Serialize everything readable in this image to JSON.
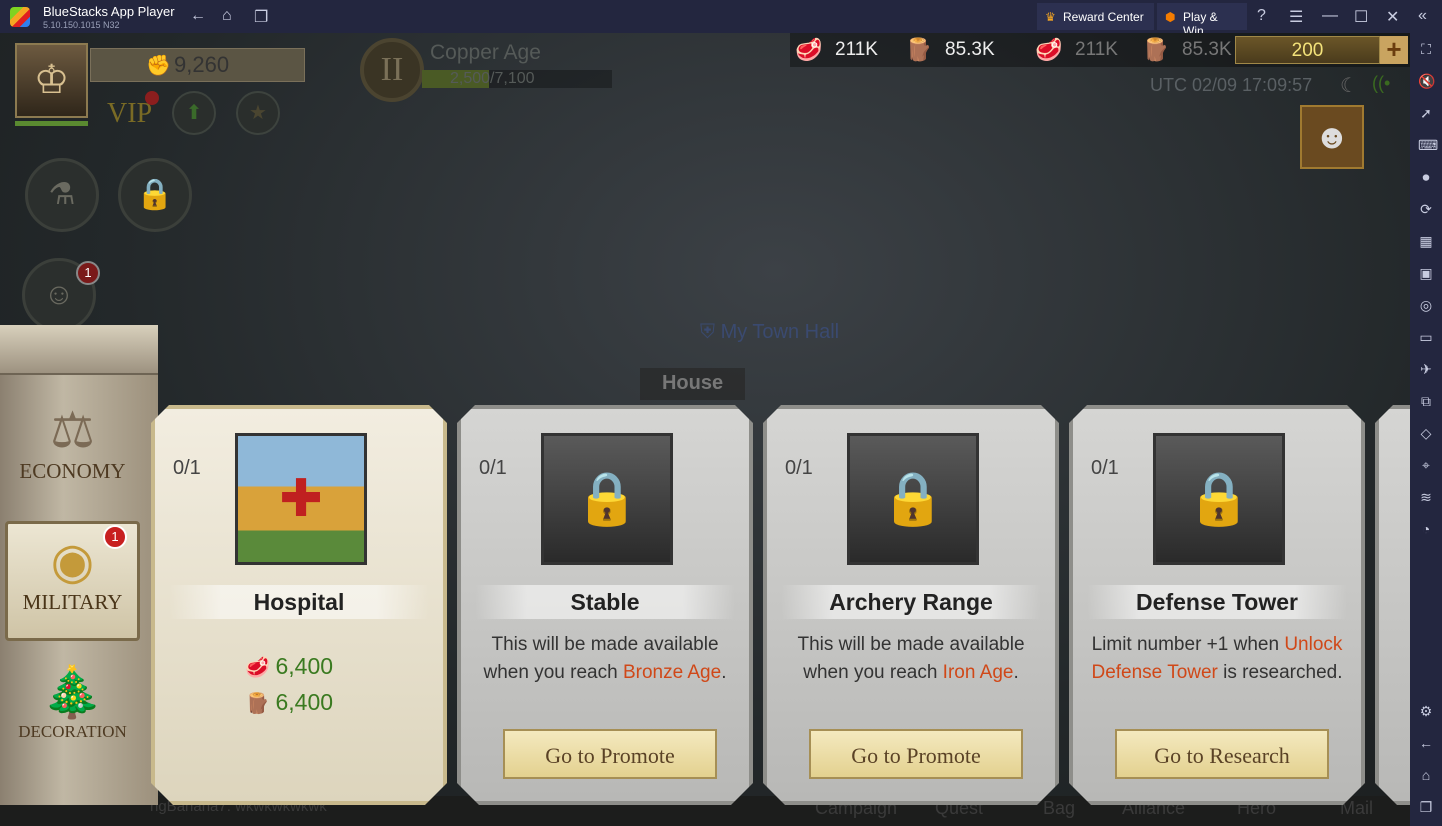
{
  "window": {
    "title": "BlueStacks App Player",
    "version": "5.10.150.1015  N32",
    "reward_center": "Reward Center",
    "play_win": "Play & Win"
  },
  "hud": {
    "power": "9,260",
    "vip": "VIP",
    "age": {
      "name": "Copper Age",
      "numeral": "II",
      "progress_text": "2,500/7,100",
      "progress": 0.352
    },
    "resources": [
      {
        "icon": "meat-icon",
        "value": "211K"
      },
      {
        "icon": "wood-icon",
        "value": "85.3K"
      },
      {
        "icon": "meat-icon",
        "value": "211K"
      },
      {
        "icon": "wood-icon",
        "value": "85.3K"
      }
    ],
    "gold": "200",
    "utc": "UTC  02/09 17:09:57",
    "notif_count": "1"
  },
  "map": {
    "town_hall": "My Town Hall",
    "house": "House"
  },
  "categories": [
    {
      "label": "ECONOMY",
      "icon": "scales-icon"
    },
    {
      "label": "MILITARY",
      "icon": "shield-spear-icon",
      "badge": "1"
    },
    {
      "label": "DECORATION",
      "icon": "tree-gift-icon"
    }
  ],
  "cards": [
    {
      "count": "0/1",
      "name": "Hospital",
      "costs": [
        "6,400",
        "6,400"
      ]
    },
    {
      "count": "0/1",
      "name": "Stable",
      "desc_pre": "This will be made available when you reach ",
      "desc_hl": "Bronze Age",
      "desc_post": ".",
      "button": "Go to Promote"
    },
    {
      "count": "0/1",
      "name": "Archery Range",
      "desc_pre": "This will be made available when you reach ",
      "desc_hl": "Iron Age",
      "desc_post": ".",
      "button": "Go to Promote"
    },
    {
      "count": "0/1",
      "name": "Defense Tower",
      "desc_pre": "Limit number +1 when ",
      "desc_hl": "Unlock Defense Tower",
      "desc_post": " is researched.",
      "button": "Go to Research"
    }
  ],
  "bottom_nav": {
    "chat": "ngBanana7: wkwkwkwkwk",
    "items": [
      "Campaign",
      "Quest",
      "Bag",
      "Alliance",
      "Hero",
      "Mail"
    ]
  },
  "colors": {
    "accent_red": "#d04818",
    "cost_green": "#3a7a20",
    "titlebar": "#23263f"
  }
}
